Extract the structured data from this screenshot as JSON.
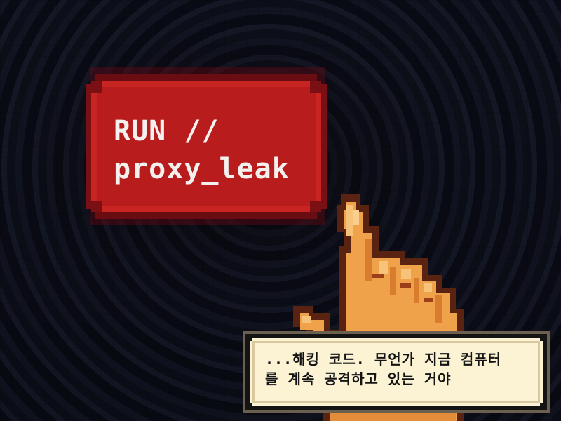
{
  "scene": {
    "command_label": "RUN //\nproxy_leak",
    "dialog_text": "...해킹 코드. 무언가 지금 컴퓨터\n를 계속 공격하고 있는 거야"
  },
  "colors": {
    "background": "#0b0c14",
    "command_red": "#b81c1d",
    "command_text": "#f4f0ee",
    "hand_orange": "#f0a24a",
    "hand_outline": "#5a2210",
    "dialog_bg": "#fbf3d4",
    "dialog_border": "#141414"
  },
  "icons": {
    "pointer": "pointing-hand-icon"
  }
}
